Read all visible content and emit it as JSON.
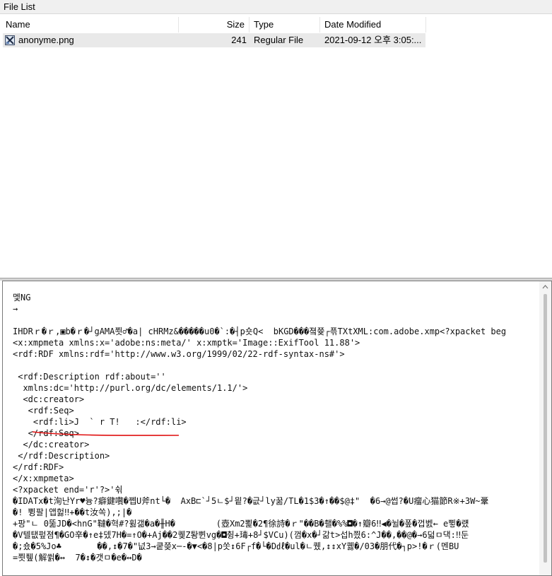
{
  "window": {
    "title": "File List"
  },
  "columns": {
    "name": "Name",
    "size": "Size",
    "type": "Type",
    "date": "Date Modified"
  },
  "files": [
    {
      "name": "anonyme.png",
      "size": "241",
      "type": "Regular File",
      "date": "2021-09-12 오후 3:05:..."
    }
  ],
  "viewer": {
    "lines": [
      "멫NG",
      "→",
      "",
      "IHDRｒ�ｒ,▣b�ｒ�┘gAMA쬣♂�a| cHRMz&�����u0�`:�┤p숏Q<  bKGD���졐쯎┌픆TXtXML:com.adobe.xmp<?xpacket beg",
      "<x:xmpmeta xmlns:x='adobe:ns:meta/' x:xmptk='Image::ExifTool 11.88'>",
      "<rdf:RDF xmlns:rdf='http://www.w3.org/1999/02/22-rdf-syntax-ns#'>",
      "",
      " <rdf:Description rdf:about=''",
      "  xmlns:dc='http://purl.org/dc/elements/1.1/'>",
      "  <dc:creator>",
      "   <rdf:Seq>",
      "    <rdf:li>J  ` r T!   :</rdf:li>",
      "   </rdf:Seq>",
      "  </dc:creator>",
      " </rdf:Description>",
      "</rdf:RDF>",
      "</x:xmpmeta>",
      "<?xpacket end='r'?>'쉮",
      "�IDATx�t洵난Yr♥늉?癖鍵嚽�쩹U斧nt└�  AxB⊏`┘5ㄴ$┘믵?�긊┘ly꿂/TL�1$3�↑��$@‡\"  �6→@썹?�U瘤心猫節R※+3W~鞷",
      "�! 쀵팔|앱헗‼+��t汝쏙),;|�",
      "+팡\"ㄴ 0뚦JD�<hnG\"韃�혁#?휧갦�a�╫H�        (壺Xm2뾡�2¶徐詩�ｒ\"��B�쵈�%%◘�↑瓣6‼◀�뉠�퐆�껍벬← e쀻�럤",
      "�V텔탮펖졈¶�GO辛�↑e‡뎄7H�=↑O�+Aj��2퀮Z퇑쀤vg�◘췽+瑇+8┘$VCu)(껌�x�┘갊t>섭h찄6:^J��,��@�→6덟ㅁ댁:‼둔",
      "�;숐�5%Jo♣       ��,↕�7�\"넚3→쿹쯪x─-�▼<�8|p쏫↕6F┌f�└�D㎗�ul�ㄴ퀬,↕↕xY퀧�/03�朋代�┐p>!�ｒ(멘BU",
      "=쬣퓊(解쓁�↔  7�↕�갯ㅁ�e�↔D�"
    ]
  }
}
